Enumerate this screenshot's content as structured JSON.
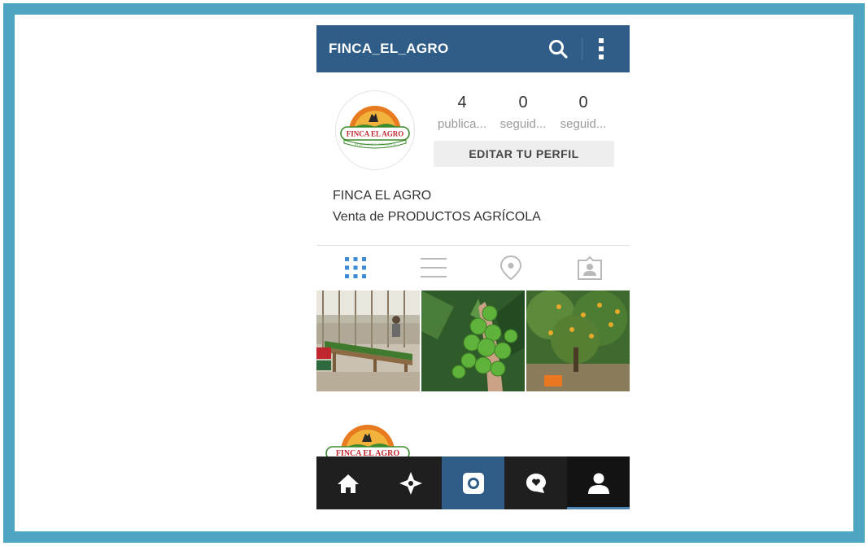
{
  "app": {
    "username": "FINCA_EL_AGRO"
  },
  "profile": {
    "logo_text": "FINCA EL AGRO",
    "logo_tagline": "Un aporte desde la calidad para Tí",
    "stats": [
      {
        "value": "4",
        "label": "publica..."
      },
      {
        "value": "0",
        "label": "seguid..."
      },
      {
        "value": "0",
        "label": "seguid..."
      }
    ],
    "edit_label": "EDITAR TU PERFIL",
    "name": "FINCA EL AGRO",
    "bio": "Venta de PRODUCTOS AGRÍCOLA"
  },
  "tabs": [
    {
      "icon": "grid-icon",
      "active": true
    },
    {
      "icon": "list-icon",
      "active": false
    },
    {
      "icon": "location-pin-icon",
      "active": false
    },
    {
      "icon": "tagged-person-icon",
      "active": false
    }
  ],
  "photos": [
    {
      "subject": "greenhouse-tables"
    },
    {
      "subject": "hand-holding-limes"
    },
    {
      "subject": "orange-tree"
    }
  ],
  "bottom_nav": [
    {
      "icon": "home-icon",
      "active": false
    },
    {
      "icon": "explore-icon",
      "active": false
    },
    {
      "icon": "camera-icon",
      "active": false
    },
    {
      "icon": "activity-icon",
      "active": false
    },
    {
      "icon": "profile-icon",
      "active": true
    }
  ],
  "colors": {
    "frame": "#4ea5c2",
    "header": "#2f5d87",
    "tab_active": "#3d8bd4",
    "tab_inactive": "#b9b9b9",
    "bottom_bar": "#1f1f1f"
  }
}
